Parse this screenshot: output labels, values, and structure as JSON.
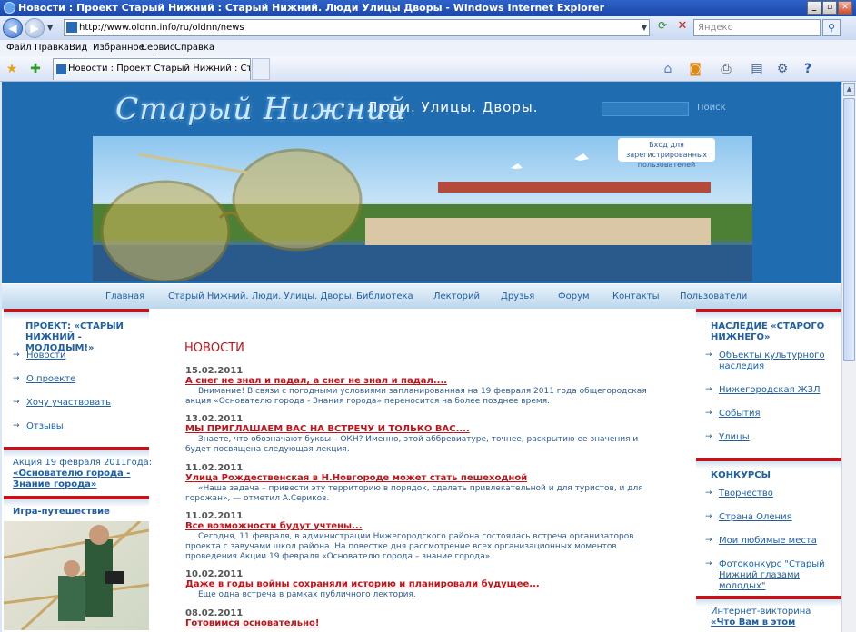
{
  "window": {
    "title": "Новости : Проект Старый Нижний : Старый Нижний. Люди Улицы Дворы - Windows Internet Explorer"
  },
  "address": {
    "url": "http://www.oldnn.info/ru/oldnn/news",
    "search_placeholder": "Яндекс"
  },
  "menu": [
    "Файл",
    "Правка",
    "Вид",
    "Избранное",
    "Сервис",
    "Справка"
  ],
  "tab": {
    "title": "Новости : Проект Старый Нижний : Старый Нижний..."
  },
  "site": {
    "logo": "Старый Нижний",
    "slogan": "Люди. Улицы. Дворы.",
    "search_button": "Поиск",
    "login": "Вход для зарегистрированных пользователей"
  },
  "nav": [
    "Главная",
    "Старый Нижний. Люди. Улицы. Дворы.",
    "Библиотека",
    "Лекторий",
    "Друзья",
    "Форум",
    "Контакты",
    "Пользователи"
  ],
  "left": {
    "project_title": "ПРОЕКТ: «СТАРЫЙ НИЖНИЙ - МОЛОДЫМ!»",
    "project_items": [
      "Новости",
      "О проекте",
      "Хочу участвовать",
      "Отзывы"
    ],
    "action_text": "Акция 19 февраля 2011года:",
    "action_link": "«Основателю города - Знание города»",
    "game_title": "Игра-путешествие"
  },
  "right": {
    "heritage_title": "НАСЛЕДИЕ «СТАРОГО НИЖНЕГО»",
    "heritage_items": [
      "Объекты культурного наследия",
      "Нижегородская ЖЗЛ",
      "События",
      "Улицы"
    ],
    "contests_title": "КОНКУРСЫ",
    "contests_items": [
      "Творчество",
      "Страна Оления",
      "Мои любимые места",
      "Фотоконкурс \"Старый Нижний глазами молодых\""
    ],
    "quiz_text": "Интернет-викторина",
    "quiz_link": "«Что Вам в этом"
  },
  "news": {
    "heading": "НОВОСТИ",
    "items": [
      {
        "date": "15.02.2011",
        "title": "А снег не знал и падал, а снег не знал и падал....",
        "text": "Внимание! В связи с погодными условиями запланированная на 19 февраля 2011 года общегородская акция «Основателю города - Знания города» переносится на более позднее время."
      },
      {
        "date": "13.02.2011",
        "title": "МЫ ПРИГЛАШАЕМ ВАС НА ВСТРЕЧУ И ТОЛЬКО ВАС....",
        "text": "Знаете, что обозначают буквы – ОКН? Именно, этой аббревиатуре, точнее, раскрытию ее значения и будет посвящена следующая лекция."
      },
      {
        "date": "11.02.2011",
        "title": "Улица Рождественская в Н.Новгороде может стать пешеходной",
        "text": "«Наша задача – привести эту территорию в порядок, сделать привлекательной и для туристов, и для горожан», — отметил А.Сериков."
      },
      {
        "date": "11.02.2011",
        "title": "Все возможности будут учтены...",
        "text": "Сегодня, 11 февраля, в администрации Нижегородского района состоялась встреча организаторов проекта с завучами школ района. На повестке дня рассмотрение всех организационных моментов проведения Акции 19 февраля «Основателю города – знание города»."
      },
      {
        "date": "10.02.2011",
        "title": "Даже в годы войны сохраняли историю и планировали будущее...",
        "text": "Еще одна встреча в рамках публичного лектория."
      },
      {
        "date": "08.02.2011",
        "title": "Готовимся основательно!",
        "text": ""
      }
    ]
  }
}
